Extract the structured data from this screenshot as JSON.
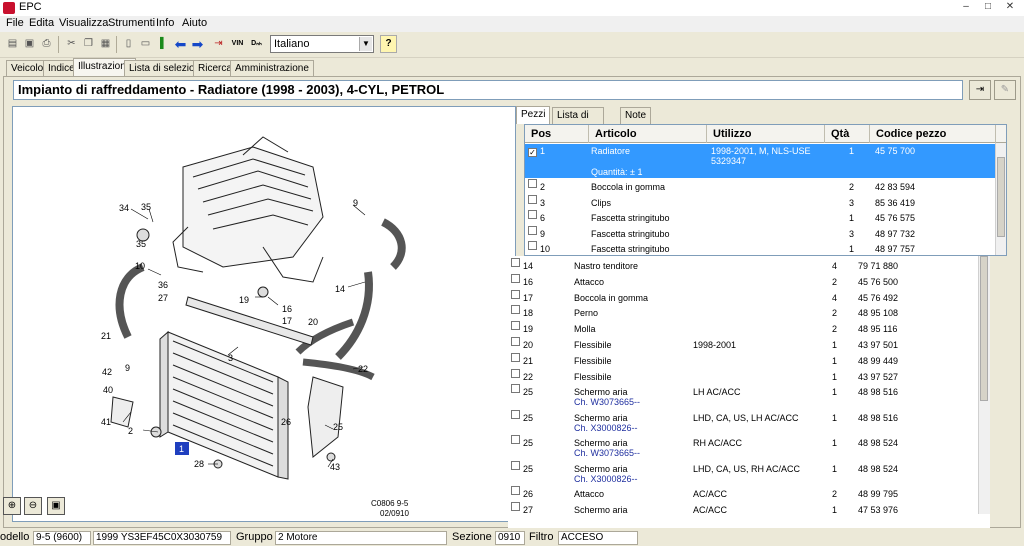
{
  "window": {
    "title": "EPC",
    "controls": [
      "–",
      "□",
      "✕"
    ]
  },
  "menu": [
    "File",
    "Edita",
    "Visualizza",
    "Strumenti",
    "Info",
    "Aiuto"
  ],
  "toolbar": {
    "language": "Italiano",
    "vin_label": "VIN",
    "dpn_label": "Dₙₕ"
  },
  "tabs": [
    "Veicolo",
    "Indice",
    "Illustrazione",
    "Lista di selezione",
    "Ricerca",
    "Amministrazione"
  ],
  "heading": "Impianto di raffreddamento - Radiatore   (1998 - 2003), 4-CYL, PETROL",
  "illustration": {
    "ref_numbers": [
      "34",
      "35",
      "35",
      "9",
      "10",
      "36",
      "27",
      "19",
      "16",
      "17",
      "14",
      "21",
      "20",
      "3",
      "42",
      "9",
      "40",
      "41",
      "2",
      "1",
      "28",
      "26",
      "25",
      "22",
      "43"
    ],
    "selected_ref": "1",
    "caption_line1": "C0806 9-5",
    "caption_line2": "02/0910"
  },
  "panel_tabs": [
    "Pezzi",
    "Lista di selezione",
    "Note"
  ],
  "table": {
    "headers": [
      "Pos",
      "Articolo",
      "Utilizzo",
      "Qtà",
      "Codice pezzo"
    ],
    "selected": {
      "pos": "1",
      "article": "Radiatore",
      "usage_line1": "1998-2001, M, NLS-USE",
      "usage_line2": "5329347",
      "qty": "1",
      "code": "45 75 700",
      "qty_note": "Quantità: ± 1"
    },
    "rows_top": [
      {
        "pos": "2",
        "article": "Boccola in gomma",
        "usage": "",
        "qty": "2",
        "code": "42 83 594"
      },
      {
        "pos": "3",
        "article": "Clips",
        "usage": "",
        "qty": "3",
        "code": "85 36 419"
      },
      {
        "pos": "6",
        "article": "Fascetta stringitubo",
        "usage": "",
        "qty": "1",
        "code": "45 76 575"
      },
      {
        "pos": "9",
        "article": "Fascetta stringitubo",
        "usage": "",
        "qty": "3",
        "code": "48 97 732"
      },
      {
        "pos": "10",
        "article": "Fascetta stringitubo",
        "usage": "",
        "qty": "1",
        "code": "48 97 757"
      }
    ],
    "rows_bottom": [
      {
        "pos": "14",
        "article": "Nastro tenditore",
        "sub": "",
        "usage": "",
        "qty": "4",
        "code": "79 71 880"
      },
      {
        "pos": "16",
        "article": "Attacco",
        "sub": "",
        "usage": "",
        "qty": "2",
        "code": "45 76 500"
      },
      {
        "pos": "17",
        "article": "Boccola in gomma",
        "sub": "",
        "usage": "",
        "qty": "4",
        "code": "45 76 492"
      },
      {
        "pos": "18",
        "article": "Perno",
        "sub": "",
        "usage": "",
        "qty": "2",
        "code": "48 95 108"
      },
      {
        "pos": "19",
        "article": "Molla",
        "sub": "",
        "usage": "",
        "qty": "2",
        "code": "48 95 116"
      },
      {
        "pos": "20",
        "article": "Flessibile",
        "sub": "",
        "usage": "1998-2001",
        "qty": "1",
        "code": "43 97 501"
      },
      {
        "pos": "21",
        "article": "Flessibile",
        "sub": "",
        "usage": "",
        "qty": "1",
        "code": "48 99 449"
      },
      {
        "pos": "22",
        "article": "Flessibile",
        "sub": "",
        "usage": "",
        "qty": "1",
        "code": "43 97 527"
      },
      {
        "pos": "25",
        "article": "Schermo aria",
        "sub": "Ch. W3073665--",
        "usage": "LH AC/ACC",
        "qty": "1",
        "code": "48 98 516"
      },
      {
        "pos": "25",
        "article": "Schermo aria",
        "sub": "Ch. X3000826--",
        "usage": "LHD, CA, US, LH AC/ACC",
        "qty": "1",
        "code": "48 98 516"
      },
      {
        "pos": "25",
        "article": "Schermo aria",
        "sub": "Ch. W3073665--",
        "usage": "RH AC/ACC",
        "qty": "1",
        "code": "48 98 524"
      },
      {
        "pos": "25",
        "article": "Schermo aria",
        "sub": "Ch. X3000826--",
        "usage": "LHD, CA, US, RH AC/ACC",
        "qty": "1",
        "code": "48 98 524"
      },
      {
        "pos": "26",
        "article": "Attacco",
        "sub": "",
        "usage": "AC/ACC",
        "qty": "2",
        "code": "48 99 795"
      },
      {
        "pos": "27",
        "article": "Schermo aria",
        "sub": "",
        "usage": "AC/ACC",
        "qty": "1",
        "code": "47 53 976"
      }
    ]
  },
  "status": {
    "model_label": "odello",
    "model_value": "9-5 (9600)",
    "vin_value": "1999 YS3EF45C0X3030759",
    "group_label": "Gruppo",
    "group_value": "2 Motore",
    "section_label": "Sezione",
    "section_value": "0910",
    "filter_label": "Filtro",
    "filter_value": "ACCESO"
  }
}
